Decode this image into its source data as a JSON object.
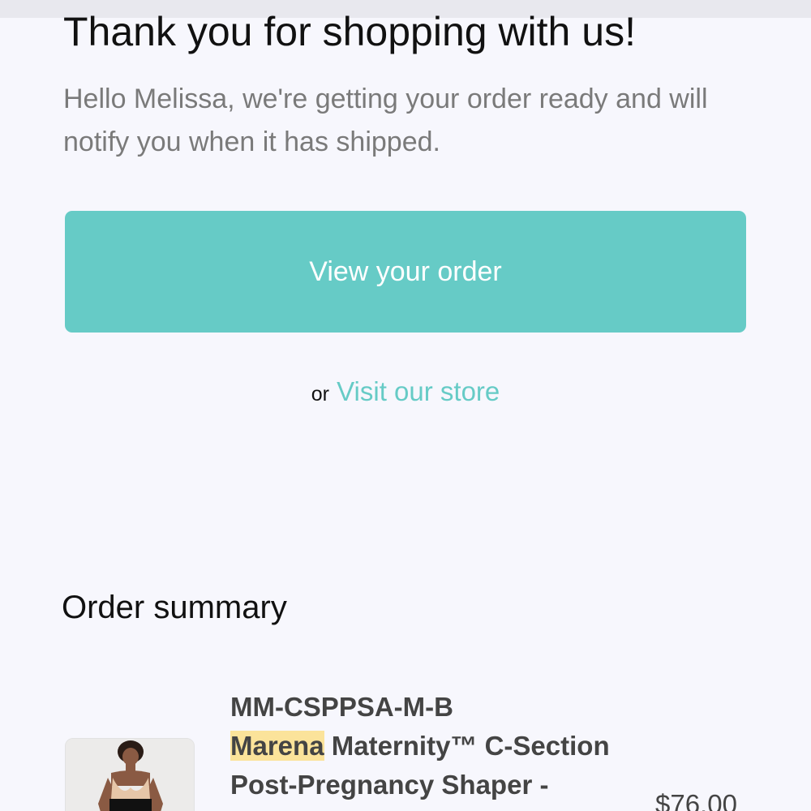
{
  "header": {
    "title": "Thank you for shopping with us!",
    "greeting": "Hello Melissa, we're getting your order ready and will notify you when it has shipped."
  },
  "actions": {
    "view_order_label": "View your order",
    "or_text": "or",
    "visit_store_label": "Visit our store"
  },
  "order_summary": {
    "title": "Order summary",
    "items": [
      {
        "sku": "MM-CSPPSA-M-B",
        "name_highlight": "Marena",
        "name_line1_rest": " Maternity™ C-Section",
        "name_line2": "Post-Pregnancy Shaper -",
        "price": "$76.00",
        "image": "product-photo"
      }
    ]
  },
  "colors": {
    "accent": "#66cbc6",
    "background": "#f7f7fd",
    "highlight": "#fbe39a",
    "muted_text": "#7a7a7a"
  }
}
